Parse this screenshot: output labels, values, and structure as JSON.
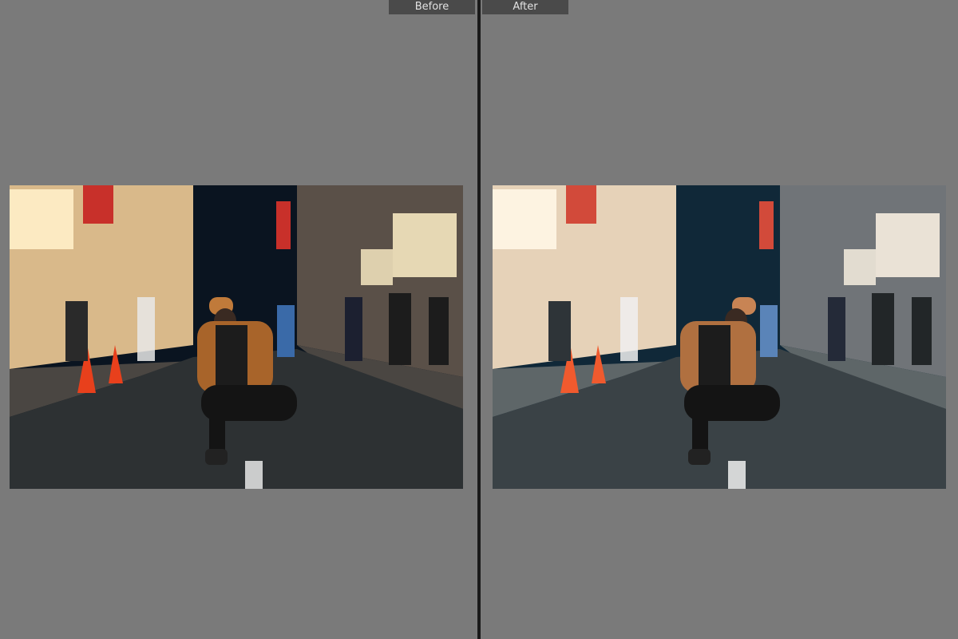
{
  "view": {
    "before_label": "Before",
    "after_label": "After"
  },
  "photos": {
    "before": {
      "sky": "#0a1420",
      "road": "#2d3133",
      "sidewalk": "#4a4642",
      "buildings_left": "#d9b98a",
      "buildings_right": "#5a5048",
      "sign_glow": "#fff0c8",
      "sign_red": "#c8302a",
      "cone": "#e8401c",
      "jacket": "#a8642a",
      "cap": "#c07a3a"
    },
    "after": {
      "sky": "#102838",
      "road": "#3a4246",
      "sidewalk": "#5e6668",
      "buildings_left": "#e6d2b8",
      "buildings_right": "#707478",
      "sign_glow": "#fff6e6",
      "sign_red": "#d24a3a",
      "cone": "#f05a2e",
      "jacket": "#b07040",
      "cap": "#c88454"
    }
  }
}
